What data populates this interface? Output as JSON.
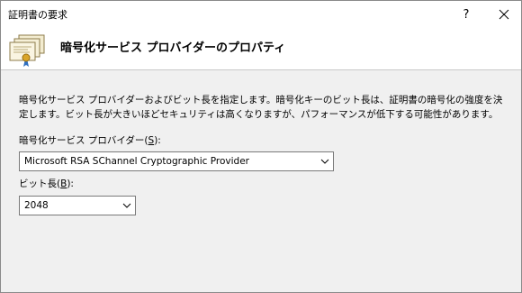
{
  "window": {
    "title": "証明書の要求",
    "help_label": "?",
    "close_icon": "close-icon"
  },
  "header": {
    "icon": "certificate-stack-icon",
    "title": "暗号化サービス プロバイダーのプロパティ"
  },
  "description": "暗号化サービス プロバイダーおよびビット長を指定します。暗号化キーのビット長は、証明書の暗号化の強度を決定します。ビット長が大きいほどセキュリティは高くなりますが、パフォーマンスが低下する可能性があります。",
  "provider": {
    "label": "暗号化サービス プロバイダー(",
    "accesskey": "S",
    "label_suffix": "):",
    "value": "Microsoft RSA SChannel Cryptographic Provider"
  },
  "bitlength": {
    "label": "ビット長(",
    "accesskey": "B",
    "label_suffix": "):",
    "value": "2048"
  }
}
